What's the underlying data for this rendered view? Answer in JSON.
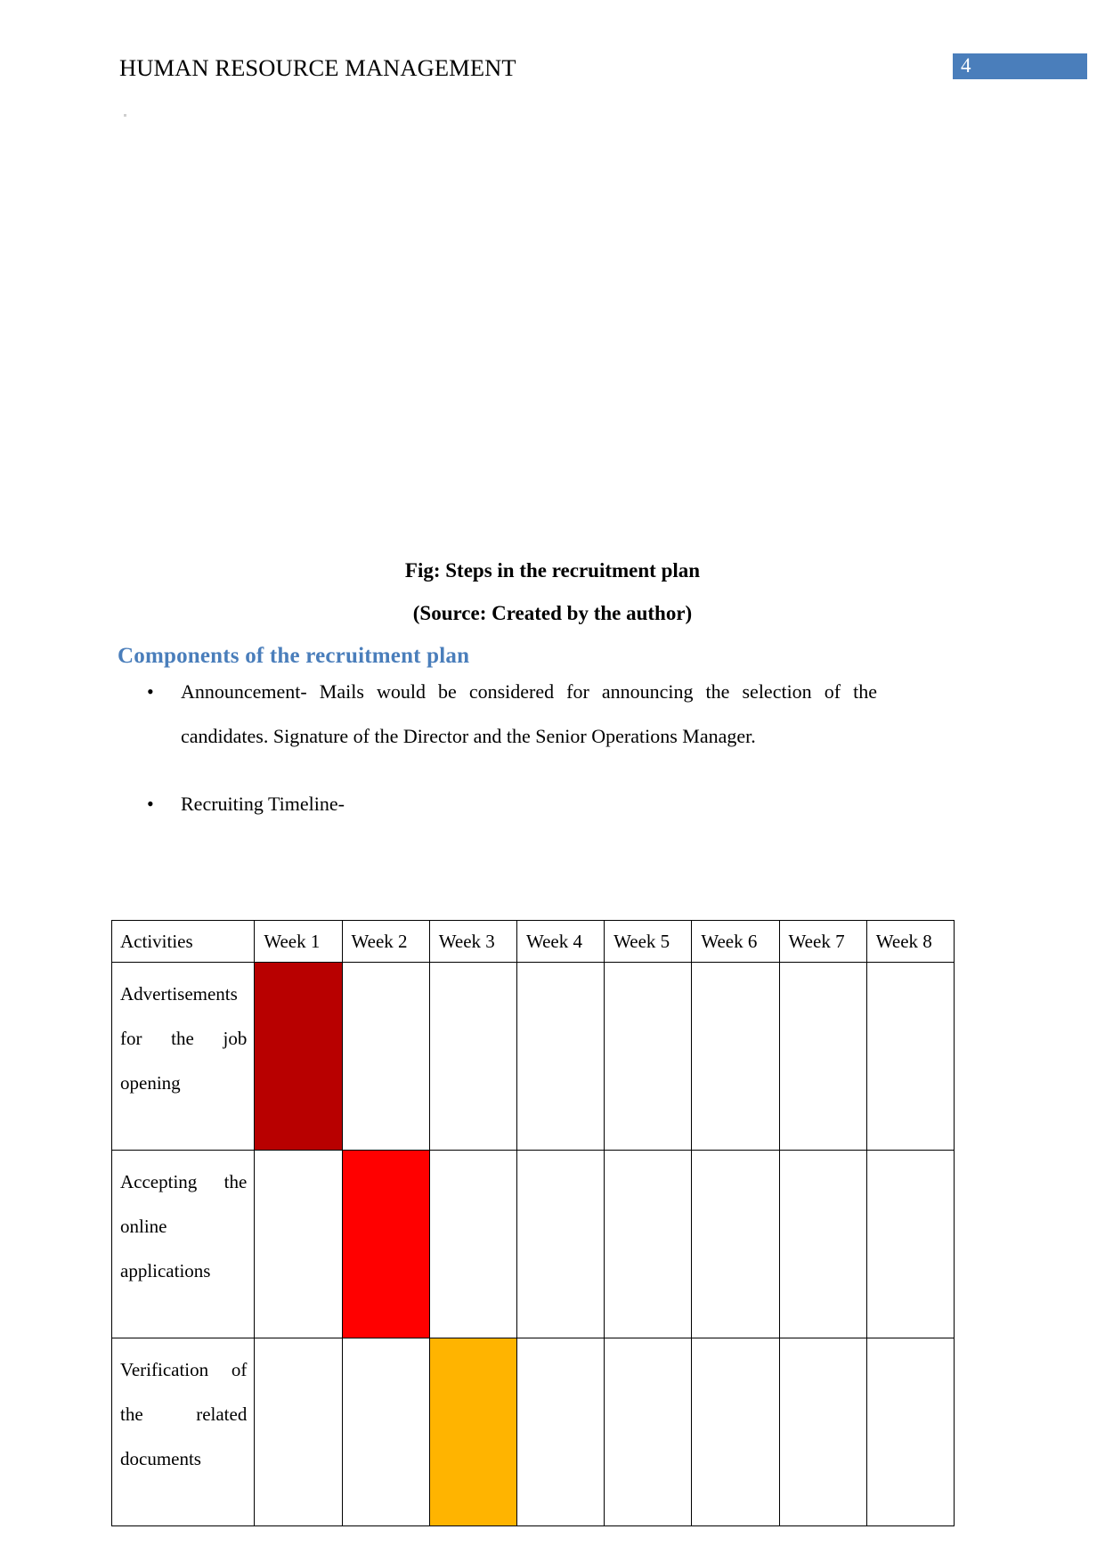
{
  "header": {
    "document_title": "HUMAN RESOURCE MANAGEMENT",
    "page_number": "4",
    "page_number_box_color": "#4A7EBB"
  },
  "figure": {
    "caption": "Fig: Steps in the recruitment plan",
    "source": "(Source: Created by the author)"
  },
  "section": {
    "heading": "Components of the recruitment plan",
    "heading_color": "#4A7EBB",
    "bullets": [
      {
        "marker": "•",
        "text": "Announcement- Mails would be considered for announcing the selection of the candidates. Signature of the Director and the Senior Operations Manager."
      },
      {
        "marker": "•",
        "text": "Recruiting Timeline-"
      }
    ]
  },
  "chart_data": {
    "type": "table",
    "title": "Recruiting Timeline",
    "categories": [
      "Week 1",
      "Week 2",
      "Week 3",
      "Week 4",
      "Week 5",
      "Week 6",
      "Week 7",
      "Week 8"
    ],
    "activities_header": "Activities",
    "rows": [
      {
        "activity": "Advertisements for the job opening",
        "filled_weeks": [
          1
        ],
        "color": "#B80000"
      },
      {
        "activity": "Accepting the online applications",
        "filled_weeks": [
          2
        ],
        "color": "#FF0000"
      },
      {
        "activity": "Verification of the related documents",
        "filled_weeks": [
          3
        ],
        "color": "#FFB400"
      }
    ]
  }
}
